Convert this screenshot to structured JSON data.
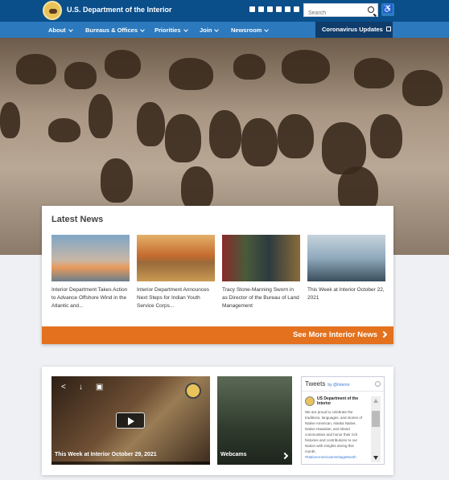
{
  "header": {
    "site_title": "U.S. Department of the Interior",
    "search_placeholder": "Search",
    "social_icons": [
      "instagram-icon",
      "facebook-icon",
      "vimeo-icon",
      "twitter-icon",
      "email-icon",
      "news-icon"
    ]
  },
  "nav": {
    "items": [
      "About",
      "Bureaus & Offices",
      "Priorities",
      "Join",
      "Newsroom"
    ],
    "covid_label": "Coronavirus Updates"
  },
  "hero": {
    "slides_total": 6,
    "active_slide": 1
  },
  "news": {
    "title": "Latest News",
    "cards": [
      {
        "text": "Interior Department Takes Action to Advance Offshore Wind in the Atlantic and..."
      },
      {
        "text": "Interior Department Announces Next Steps for Indian Youth Service Corps..."
      },
      {
        "text": "Tracy Stone-Manning Sworn in as Director of the Bureau of Land Management"
      },
      {
        "text": "This Week at Interior October 22, 2021"
      }
    ],
    "more_label": "See More Interior News"
  },
  "media": {
    "video_caption": "This Week at Interior October 29, 2021",
    "webcam_caption": "Webcams",
    "tweets": {
      "title": "Tweets",
      "by": "by @Interior",
      "account": "US Department of the Interior",
      "body": "We are proud to celebrate the traditions, languages, and stories of Native American, Alaska Native, Native Hawaiian, and Island communities and honor their rich histories and contributions to our Nation with insights during this month.",
      "hashtag": "#NativeAmericanHeritageMonth"
    }
  }
}
